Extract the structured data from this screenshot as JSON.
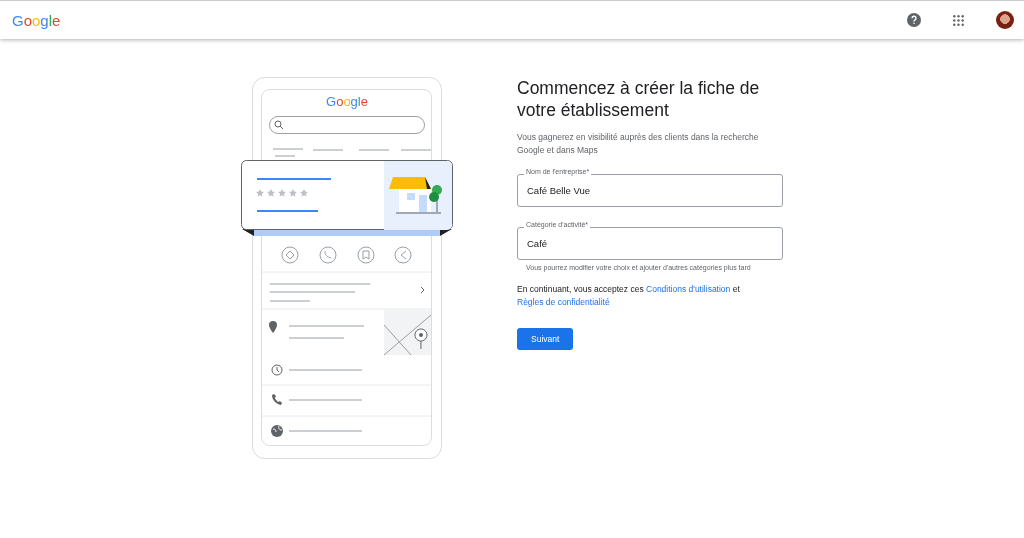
{
  "header": {
    "logo": "Google"
  },
  "illustration": {
    "logo": "Google"
  },
  "form": {
    "title": "Commencez à créer la fiche de votre établissement",
    "subtitle": "Vous gagnerez en visibilité auprès des clients dans la recherche Google et dans Maps",
    "fields": [
      {
        "label": "Nom de l'entreprise*",
        "value": "Café Belle Vue"
      },
      {
        "label": "Catégorie d'activité*",
        "value": "Café",
        "helper": "Vous pourrez modifier votre choix et ajouter d'autres catégories plus tard"
      }
    ],
    "terms": {
      "before": "En continuant, vous acceptez ces",
      "link_1": "Conditions d'utilisation",
      "middle": "et",
      "link_2": "Règles de confidentialité"
    },
    "button": "Suivant"
  }
}
